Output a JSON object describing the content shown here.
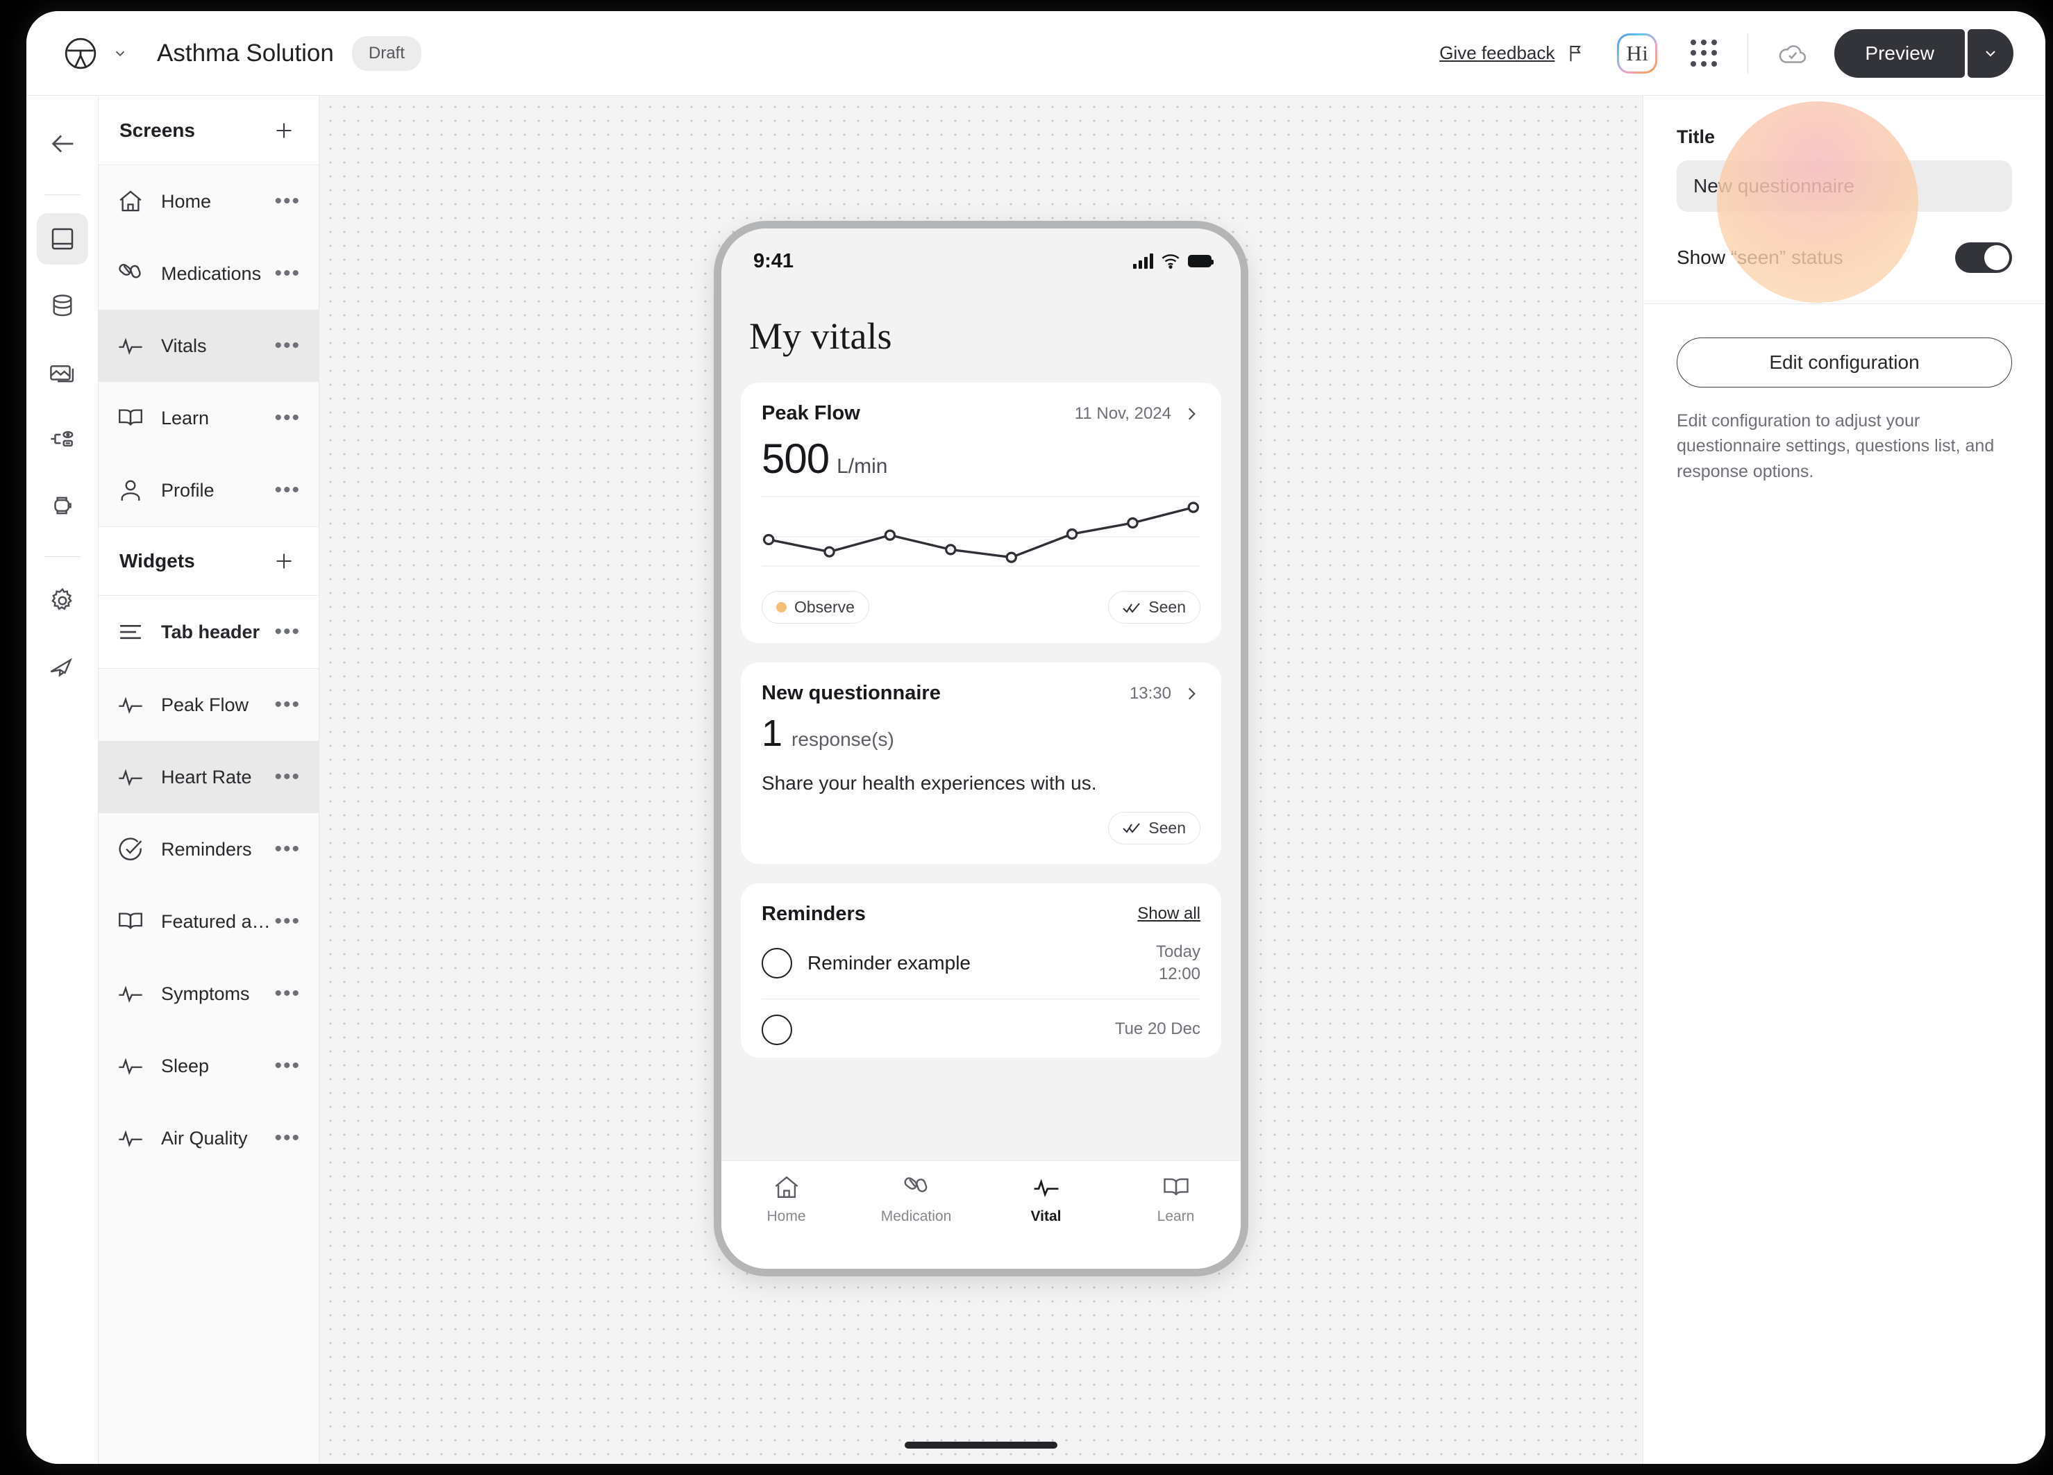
{
  "topbar": {
    "logo_icon": "brand-logo-icon",
    "logo_caret_icon": "chevron-down-icon",
    "app_title": "Asthma Solution",
    "status_badge": "Draft",
    "feedback_label": "Give feedback",
    "flag_icon": "flag-icon",
    "hi_badge": "Hi",
    "apps_icon": "apps-grid-icon",
    "save_status_icon": "cloud-check-icon",
    "preview_label": "Preview",
    "preview_caret_icon": "chevron-down-icon"
  },
  "icon_rail": {
    "back_icon": "arrow-left-icon",
    "items": [
      {
        "name": "screens",
        "icon": "mobile-screen-icon",
        "selected": true
      },
      {
        "name": "data",
        "icon": "database-icon",
        "selected": false
      },
      {
        "name": "media",
        "icon": "images-icon",
        "selected": false
      },
      {
        "name": "flows",
        "icon": "flow-branch-icon",
        "selected": false
      },
      {
        "name": "devices",
        "icon": "smartwatch-icon",
        "selected": false
      },
      {
        "name": "settings",
        "icon": "gear-icon",
        "selected": false
      },
      {
        "name": "deploy",
        "icon": "rocket-icon",
        "selected": false
      }
    ]
  },
  "screens_panel": {
    "title": "Screens",
    "add_icon": "plus-icon",
    "more_icon": "ellipsis-icon",
    "items": [
      {
        "label": "Home",
        "icon": "home-icon",
        "active": false
      },
      {
        "label": "Medications",
        "icon": "pills-icon",
        "active": false
      },
      {
        "label": "Vitals",
        "icon": "pulse-icon",
        "active": true
      },
      {
        "label": "Learn",
        "icon": "book-icon",
        "active": false
      },
      {
        "label": "Profile",
        "icon": "person-icon",
        "active": false
      }
    ]
  },
  "widgets_panel": {
    "title": "Widgets",
    "add_icon": "plus-icon",
    "items": [
      {
        "label": "Tab header",
        "icon": "lines-icon",
        "active": false,
        "bold": true
      },
      {
        "label": "Peak Flow",
        "icon": "pulse-icon",
        "active": false,
        "bold": false
      },
      {
        "label": "Heart Rate",
        "icon": "pulse-icon",
        "active": true,
        "bold": false
      },
      {
        "label": "Reminders",
        "icon": "check-circle-icon",
        "active": false,
        "bold": false
      },
      {
        "label": "Featured articles",
        "icon": "book-icon",
        "active": false,
        "bold": false
      },
      {
        "label": "Symptoms",
        "icon": "pulse-icon",
        "active": false,
        "bold": false
      },
      {
        "label": "Sleep",
        "icon": "pulse-icon",
        "active": false,
        "bold": false
      },
      {
        "label": "Air Quality",
        "icon": "pulse-icon",
        "active": false,
        "bold": false
      }
    ]
  },
  "phone": {
    "status_time": "9:41",
    "signal_icon": "cellular-signal-icon",
    "wifi_icon": "wifi-icon",
    "battery_icon": "battery-full-icon",
    "screen_title": "My vitals",
    "peak_flow_card": {
      "title": "Peak Flow",
      "date": "11 Nov, 2024",
      "chevron_icon": "chevron-right-icon",
      "value": "500",
      "unit": "L/min",
      "status_pill": "Observe",
      "status_dot_color": "#F5C078",
      "seen_pill": "Seen",
      "seen_icon": "double-check-icon"
    },
    "questionnaire_card": {
      "title": "New questionnaire",
      "time": "13:30",
      "chevron_icon": "chevron-right-icon",
      "count": "1",
      "count_label": "response(s)",
      "description": "Share your health experiences with us.",
      "seen_pill": "Seen",
      "seen_icon": "double-check-icon"
    },
    "reminders_card": {
      "title": "Reminders",
      "show_all": "Show all",
      "items": [
        {
          "label": "Reminder example",
          "day": "Today",
          "time": "12:00"
        },
        {
          "label": "",
          "day": "Tue 20 Dec",
          "time": ""
        }
      ]
    },
    "tabbar": [
      {
        "label": "Home",
        "icon": "home-icon",
        "active": false
      },
      {
        "label": "Medication",
        "icon": "pills-icon",
        "active": false
      },
      {
        "label": "Vital",
        "icon": "pulse-icon",
        "active": true
      },
      {
        "label": "Learn",
        "icon": "book-icon",
        "active": false
      }
    ]
  },
  "right_panel": {
    "title_label": "Title",
    "title_value": "New questionnaire",
    "title_placeholder": "New questionnaire",
    "toggle_label": "Show “seen” status",
    "toggle_on": true,
    "edit_button": "Edit configuration",
    "helper_text": "Edit configuration to adjust your questionnaire settings, questions list, and response options."
  },
  "chart_data": {
    "type": "line",
    "title": "Peak Flow",
    "xlabel": "",
    "ylabel": "L/min",
    "x": [
      1,
      2,
      3,
      4,
      5,
      6,
      7,
      8
    ],
    "values": [
      470,
      448,
      478,
      452,
      438,
      480,
      500,
      528
    ],
    "ylim": [
      420,
      545
    ],
    "grid": true,
    "gridlines": [
      545,
      462,
      420
    ],
    "legend": "none",
    "marker": "open-circle",
    "line_color": "#2e3036"
  }
}
